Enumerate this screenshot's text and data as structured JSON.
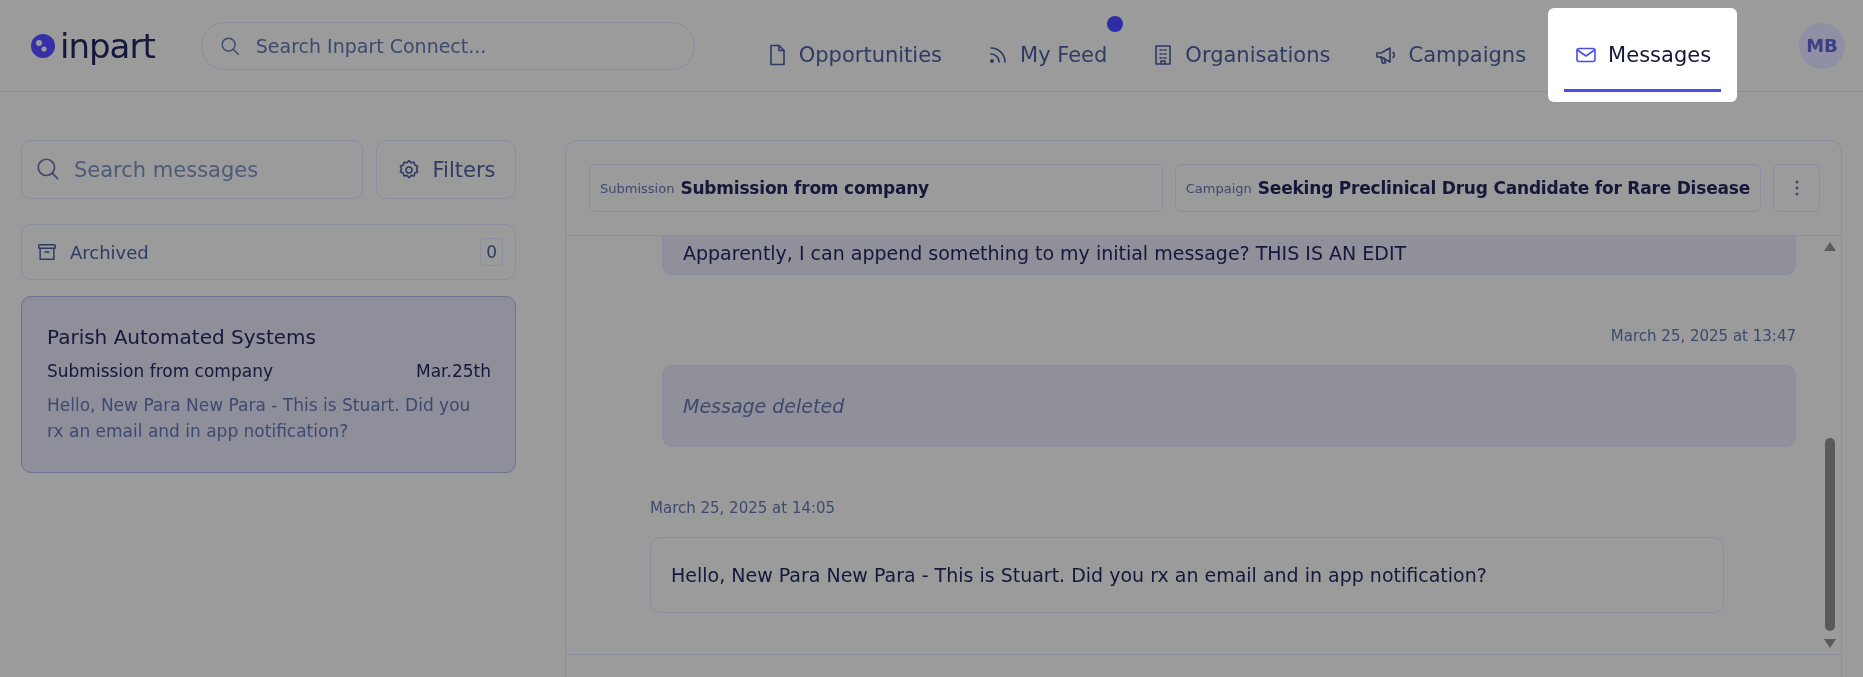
{
  "header": {
    "logo": "inpart",
    "search": {
      "placeholder": "Search Inpart Connect..."
    },
    "nav": [
      {
        "label": "Opportunities",
        "kind": "document",
        "selected": false,
        "has_notification": false
      },
      {
        "label": "My Feed",
        "kind": "feed",
        "selected": false,
        "has_notification": true
      },
      {
        "label": "Organisations",
        "kind": "building",
        "selected": false,
        "has_notification": false
      },
      {
        "label": "Campaigns",
        "kind": "megaphone",
        "selected": false,
        "has_notification": false
      },
      {
        "label": "Messages",
        "kind": "envelope",
        "selected": true,
        "has_notification": false
      }
    ],
    "avatar": "MB"
  },
  "sidebar": {
    "search": {
      "placeholder": "Search messages"
    },
    "filters_button": "Filters",
    "archived": {
      "label": "Archived",
      "count": "0"
    },
    "conversations": [
      {
        "name": "Parish Automated Systems",
        "subject": "Submission from company",
        "date": "Mar.25th",
        "preview": "Hello, New Para New Para - This is Stuart. Did you rx an email and in app notification?",
        "selected": true
      }
    ]
  },
  "conversation": {
    "tags": [
      {
        "label": "Submission",
        "value": "Submission from company"
      },
      {
        "label": "Campaign",
        "value": "Seeking Preclinical Drug Candidate for Rare Disease"
      }
    ],
    "messages": [
      {
        "kind": "sent",
        "text": "Apparently, I can append something to my initial message? THIS IS AN EDIT"
      },
      {
        "kind": "deleted",
        "timestamp": "March 25, 2025 at 13:47",
        "text": "Message deleted"
      },
      {
        "kind": "received",
        "timestamp": "March 25, 2025 at 14:05",
        "text": "Hello, New Para New Para - This is Stuart. Did you rx an email and in app notification?"
      }
    ]
  }
}
